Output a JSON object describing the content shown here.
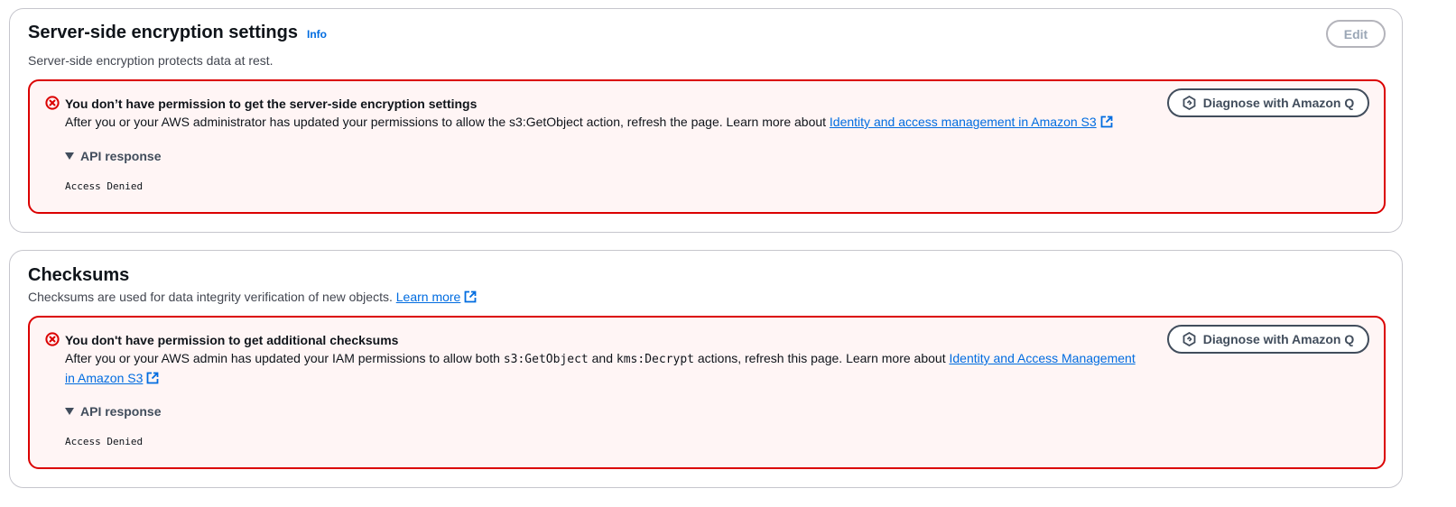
{
  "sse": {
    "title": "Server-side encryption settings",
    "info": "Info",
    "description": "Server-side encryption protects data at rest.",
    "edit_label": "Edit",
    "alert": {
      "title": "You don’t have permission to get the server-side encryption settings",
      "text": "After you or your AWS administrator has updated your permissions to allow the s3:GetObject action, refresh the page. Learn more about ",
      "link": "Identity and access management in Amazon S3",
      "diagnose_label": "Diagnose with Amazon Q",
      "api_toggle": "API response",
      "api_value": "Access Denied"
    }
  },
  "checksums": {
    "title": "Checksums",
    "description": "Checksums are used for data integrity verification of new objects. ",
    "learn_more": "Learn more",
    "alert": {
      "title": "You don't have permission to get additional checksums",
      "text_1": "After you or your AWS admin has updated your IAM permissions to allow both ",
      "code_1": "s3:GetObject",
      "text_2": " and ",
      "code_2": "kms:Decrypt",
      "text_3": " actions, refresh this page. Learn more about ",
      "link": "Identity and Access Management in Amazon S3",
      "diagnose_label": "Diagnose with Amazon Q",
      "api_toggle": "API response",
      "api_value": "Access Denied"
    }
  },
  "colors": {
    "error_red": "#db0000",
    "alert_bg": "#fff5f5",
    "link_blue": "#006ce0",
    "border_gray": "#c6c6cd"
  },
  "icons": [
    "error-icon",
    "external-link-icon",
    "amazon-q-icon",
    "caret-down-icon"
  ]
}
